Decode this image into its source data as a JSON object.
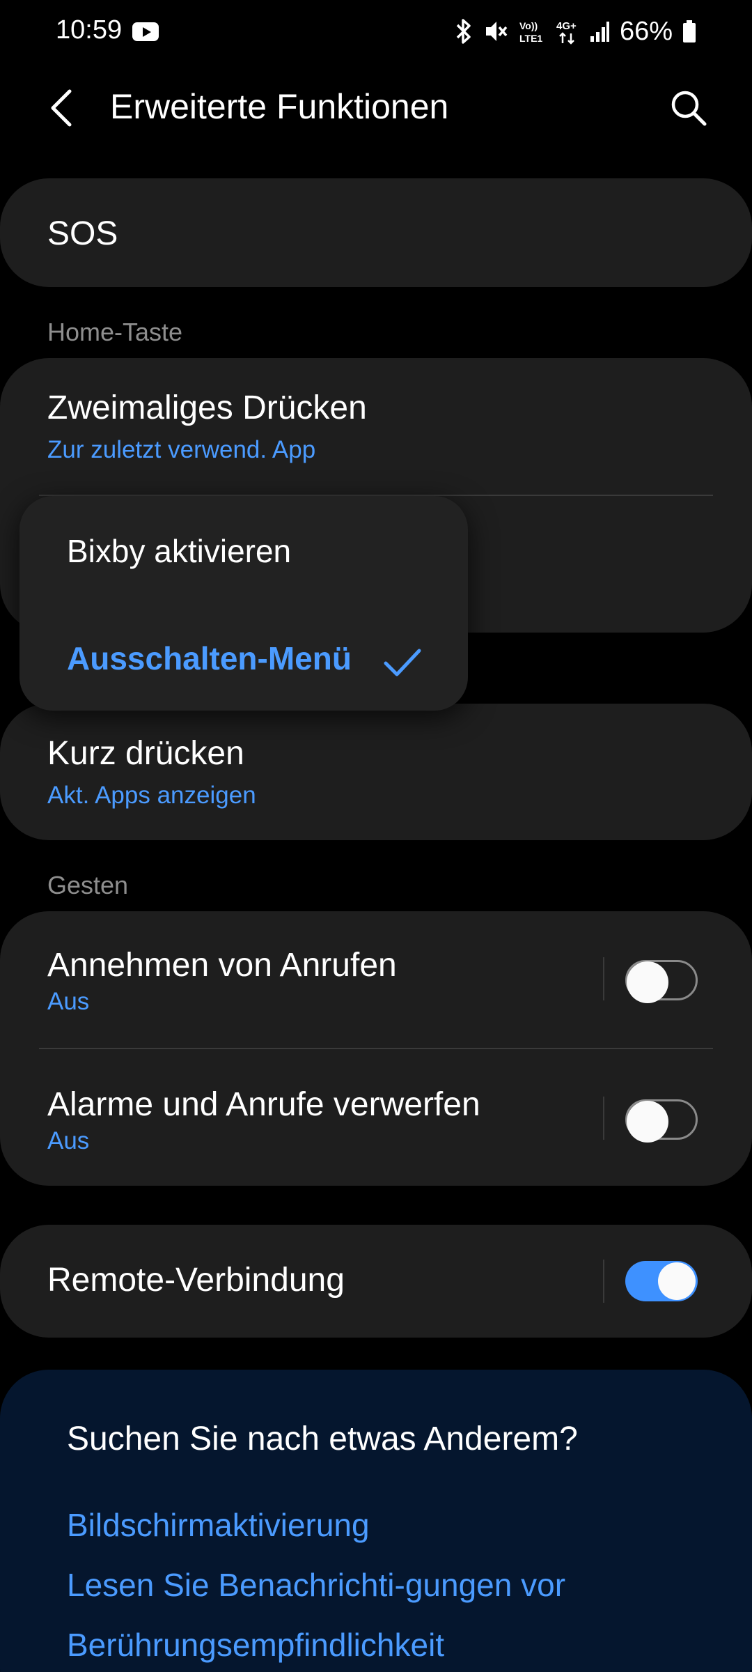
{
  "status_bar": {
    "time": "10:59",
    "battery": "66%",
    "icons": [
      "youtube-icon",
      "bluetooth-icon",
      "mute-icon",
      "volte-icon",
      "4g-icon",
      "signal-icon",
      "battery-icon"
    ],
    "volte_label": "Vo)) LTE1",
    "network_label": "4G+"
  },
  "app_bar": {
    "title": "Erweiterte Funktionen",
    "back_icon": "back-arrow-icon",
    "search_icon": "search-icon"
  },
  "sos": {
    "label": "SOS"
  },
  "home_key": {
    "header": "Home-Taste",
    "double_press": {
      "title": "Zweimaliges Drücken",
      "value": "Zur zuletzt verwend. App"
    }
  },
  "dropdown": {
    "options": [
      {
        "label": "Bixby aktivieren",
        "selected": false
      },
      {
        "label": "Ausschalten-Menü",
        "selected": true
      }
    ],
    "check_icon": "checkmark-icon"
  },
  "short_press": {
    "title": "Kurz drücken",
    "value": "Akt. Apps anzeigen"
  },
  "gestures": {
    "header": "Gesten",
    "items": [
      {
        "title": "Annehmen von Anrufen",
        "value": "Aus",
        "on": false
      },
      {
        "title": "Alarme und Anrufe verwerfen",
        "value": "Aus",
        "on": false
      }
    ]
  },
  "remote": {
    "title": "Remote-Verbindung",
    "on": true
  },
  "suggestions": {
    "title": "Suchen Sie nach etwas Anderem?",
    "links": [
      "Bildschirmaktivierung",
      "Lesen Sie Benachrichti-gungen vor",
      "Berührungsempfindlichkeit"
    ]
  },
  "colors": {
    "background": "#000000",
    "card": "#1e1e1e",
    "accent": "#4b9bff",
    "toggle_on": "#3e91ff",
    "suggestion_card": "#05162e"
  }
}
